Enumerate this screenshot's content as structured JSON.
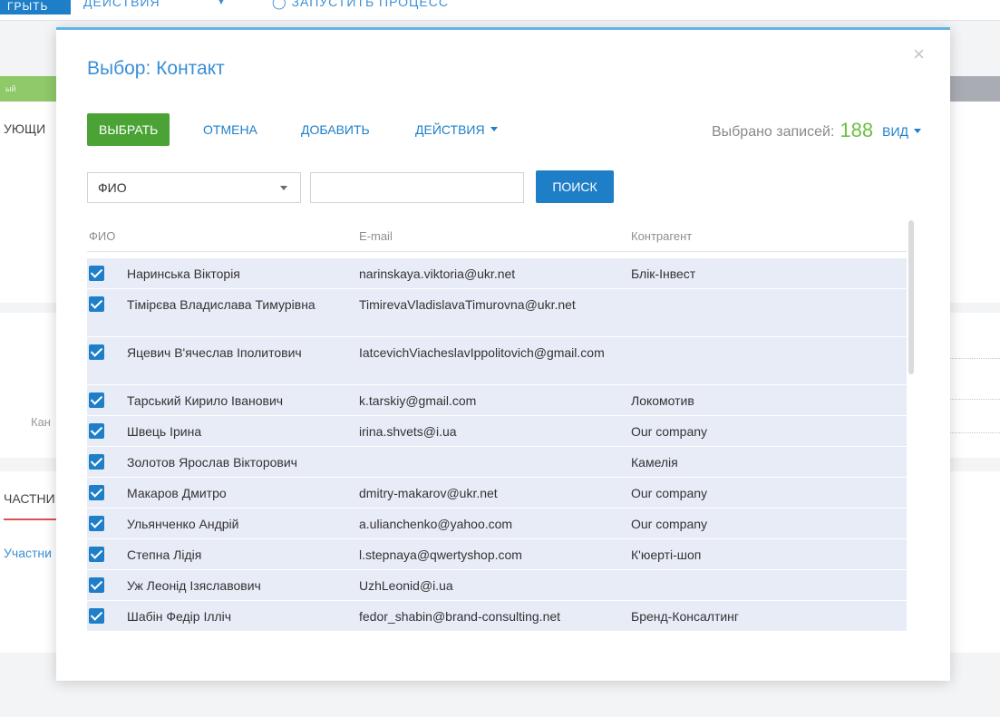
{
  "background": {
    "top_button": "ГРЫТЬ",
    "top_actions": "ДЕЙСТВИЯ",
    "top_run": "◯ ЗАПУСТИТЬ ПРОЦЕСС",
    "green_label": "ый",
    "tab_label": "УЮЩИ",
    "field_label": "Кан",
    "section_title": "ЧАСТНИ",
    "section_link": "Участни"
  },
  "modal": {
    "title": "Выбор: Контакт",
    "close_glyph": "×",
    "toolbar": {
      "select_label": "ВЫБРАТЬ",
      "cancel_label": "ОТМЕНА",
      "add_label": "ДОБАВИТЬ",
      "actions_label": "ДЕЙСТВИЯ",
      "selected_label": "Выбрано записей:",
      "selected_count": "188",
      "view_label": "ВИД"
    },
    "filter": {
      "field_value": "ФИО",
      "search_value": "",
      "search_label": "ПОИСК"
    },
    "grid": {
      "columns": [
        "ФИО",
        "E-mail",
        "Контрагент"
      ],
      "rows": [
        {
          "name": "Наринська Вікторія",
          "email": "narinskaya.viktoria@ukr.net",
          "account": "Блік-Інвест",
          "checked": true
        },
        {
          "name": "Тімірєва Владислава Тимурівна",
          "email": "TimirevaVladislavaTimurovna@ukr.net",
          "account": "",
          "checked": true
        },
        {
          "name": "Яцевич В'ячеслав Іполитович",
          "email": "IatcevichViacheslavIppolitovich@gmail.com",
          "account": "",
          "checked": true
        },
        {
          "name": "Тарський Кирило Іванович",
          "email": "k.tarskiy@gmail.com",
          "account": "Локомотив",
          "checked": true
        },
        {
          "name": "Швець Ірина",
          "email": "irina.shvets@i.ua",
          "account": "Our company",
          "checked": true
        },
        {
          "name": "Золотов Ярослав Вікторович",
          "email": "",
          "account": "Камелія",
          "checked": true
        },
        {
          "name": "Макаров Дмитро",
          "email": "dmitry-makarov@ukr.net",
          "account": "Our company",
          "checked": true
        },
        {
          "name": "Ульянченко Андрій",
          "email": "a.ulianchenko@yahoo.com",
          "account": "Our company",
          "checked": true
        },
        {
          "name": "Степна Лідія",
          "email": "l.stepnaya@qwertyshop.com",
          "account": "К'юерті-шоп",
          "checked": true
        },
        {
          "name": "Уж Леонід Ізяславович",
          "email": "UzhLeonid@i.ua",
          "account": "",
          "checked": true
        },
        {
          "name": "Шабін Федір Ілліч",
          "email": "fedor_shabin@brand-consulting.net",
          "account": "Бренд-Консалтинг",
          "checked": true
        }
      ]
    }
  },
  "colors": {
    "accent_blue": "#1e7fc8",
    "select_green": "#4aa334",
    "count_green": "#6cbf43",
    "row_bg": "#e8ecf7",
    "modal_top_border": "#64b3e8"
  },
  "icons": {
    "close": "close-icon",
    "dropdown": "chevron-down-icon",
    "checkbox": "checkbox-checked-icon"
  }
}
